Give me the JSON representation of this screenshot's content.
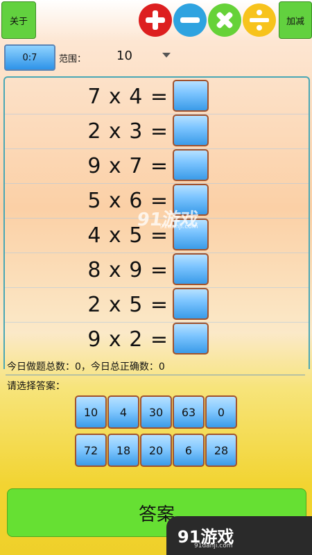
{
  "toolbar": {
    "about_label": "关于",
    "addsub_label": "加减",
    "ops": [
      "plus-icon",
      "minus-icon",
      "multiply-icon",
      "divide-icon"
    ],
    "op_colors": [
      "#dd1f1f",
      "#2ea3e0",
      "#66d238",
      "#f7c31c"
    ]
  },
  "filter": {
    "ratio": "0:7",
    "range_label": "范围：",
    "range_value": "10"
  },
  "questions": [
    "7 x 4 =",
    "2 x 3 =",
    "9 x 7 =",
    "5 x 6 =",
    "4 x 5 =",
    "8 x 9 =",
    "2 x 5 =",
    "9 x 2 ="
  ],
  "stats": "今日做题总数：0，今日总正确数：0",
  "prompt": "请选择答案：",
  "choices": {
    "row1": [
      "10",
      "4",
      "30",
      "63",
      "0"
    ],
    "row2": [
      "72",
      "18",
      "20",
      "6",
      "28"
    ]
  },
  "answer_label": "答案",
  "watermark": {
    "text": "91游戏",
    "sub": "91danji.com"
  }
}
